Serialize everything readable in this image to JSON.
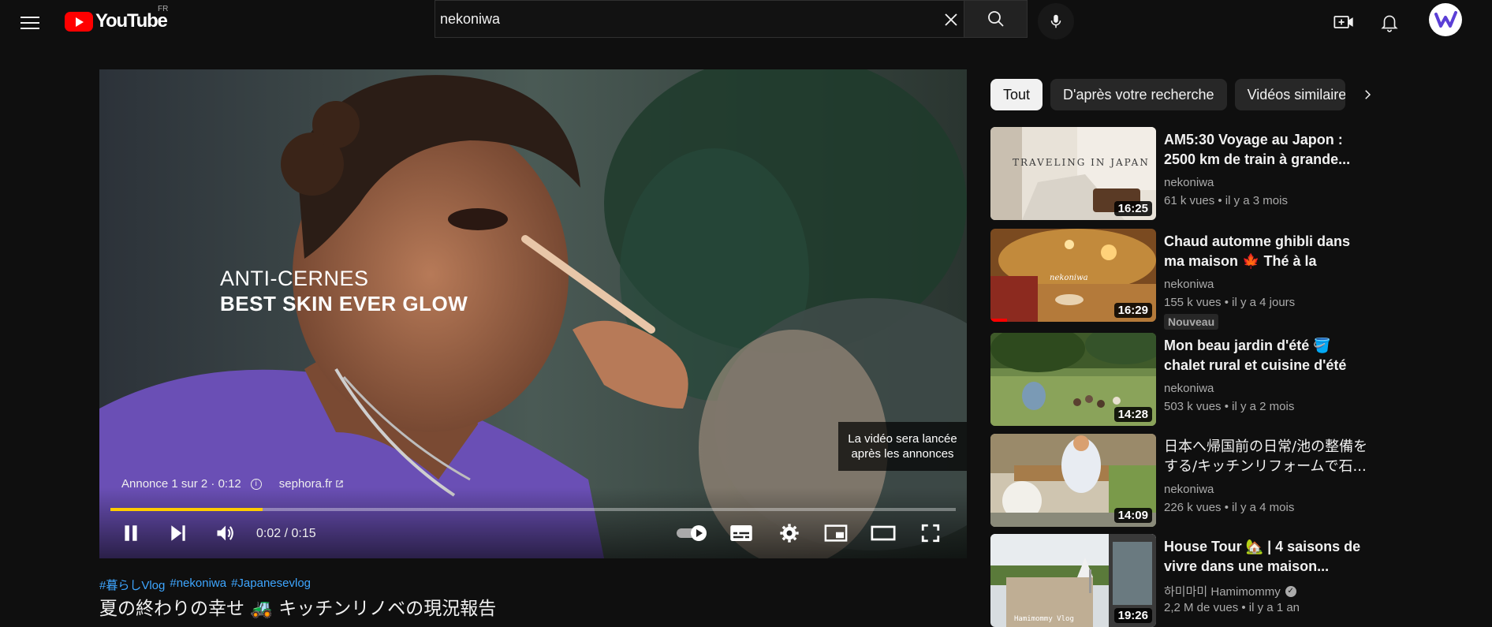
{
  "masthead": {
    "logo_text": "YouTube",
    "country_code": "FR",
    "search_value": "nekoniwa"
  },
  "player": {
    "ad_line1": "ANTI-CERNES",
    "ad_line2": "BEST SKIN EVER GLOW",
    "skip_notice": "La vidéo sera lancée après les annonces",
    "ad_info": "Annonce 1 sur 2 · 0:12",
    "ad_link": "sephora.fr",
    "time": "0:02 / 0:15",
    "progress": 0.18
  },
  "video": {
    "hashtags": [
      "#暮らしVlog",
      "#nekoniwa",
      "#Japanesevlog"
    ],
    "title": "夏の終わりの幸せ 🚜 キッチンリノベの現況報告"
  },
  "chips": [
    {
      "label": "Tout",
      "active": true
    },
    {
      "label": "D'après votre recherche",
      "active": false
    },
    {
      "label": "Vidéos similaires",
      "active": false
    }
  ],
  "recommendations": [
    {
      "title": "AM5:30 Voyage au Japon : 2500 km de train à grande...",
      "channel": "nekoniwa",
      "meta": "61 k vues • il y a 3 mois",
      "duration": "16:25",
      "thumb_text": "TRAVELING IN JAPAN"
    },
    {
      "title": "Chaud automne ghibli dans ma maison 🍁 Thé à la camomille...",
      "channel": "nekoniwa",
      "meta": "155 k vues • il y a 4 jours",
      "duration": "16:29",
      "badge": "Nouveau",
      "thumb_text": "nekoniwa",
      "watched": 0.1
    },
    {
      "title": "Mon beau jardin d'été 🪣 chalet rural et cuisine d'été",
      "channel": "nekoniwa",
      "meta": "503 k vues • il y a 2 mois",
      "duration": "14:28"
    },
    {
      "title": "日本へ帰国前の日常/池の整備をする/キッチンリフォームで石...",
      "channel": "nekoniwa",
      "meta": "226 k vues • il y a 4 mois",
      "duration": "14:09"
    },
    {
      "title": "House Tour 🏡 | 4 saisons de vivre dans une maison...",
      "channel": "하미마미 Hamimommy",
      "meta": "2,2 M de vues • il y a 1 an",
      "duration": "19:26",
      "verified": true,
      "thumb_text": "Hamimommy Vlog"
    }
  ]
}
